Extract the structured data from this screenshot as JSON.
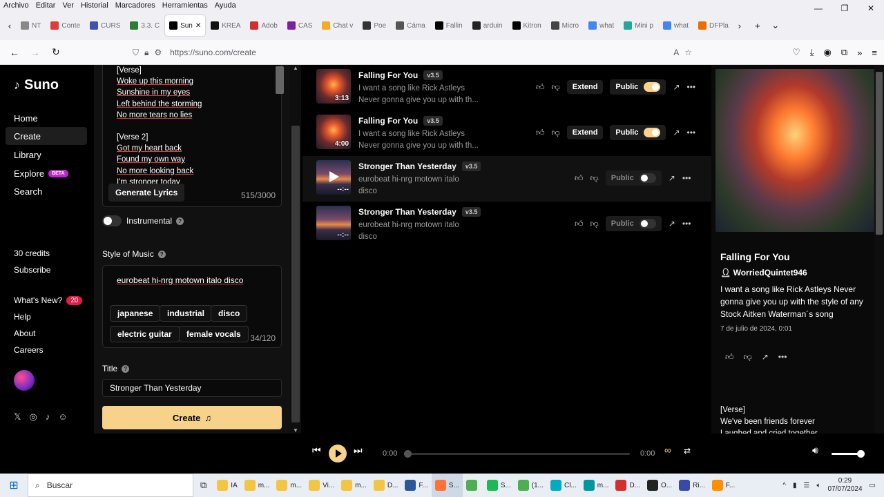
{
  "browser": {
    "menu": [
      "Archivo",
      "Editar",
      "Ver",
      "Historial",
      "Marcadores",
      "Herramientas",
      "Ayuda"
    ],
    "tabs": [
      {
        "label": "NT",
        "color": "#888888"
      },
      {
        "label": "Conte",
        "color": "#e53935"
      },
      {
        "label": "CURS",
        "color": "#3f51b5"
      },
      {
        "label": "3.3. C",
        "color": "#2e7d32"
      },
      {
        "label": "Sun",
        "color": "#000000",
        "active": true
      },
      {
        "label": "KREA",
        "color": "#111111"
      },
      {
        "label": "Adob",
        "color": "#d32f2f"
      },
      {
        "label": "CAS",
        "color": "#7b1fa2"
      },
      {
        "label": "Chat v",
        "color": "#f9a825"
      },
      {
        "label": "Poe",
        "color": "#333333"
      },
      {
        "label": "Cáma",
        "color": "#555555"
      },
      {
        "label": "Fallin",
        "color": "#000000"
      },
      {
        "label": "arduin",
        "color": "#222222"
      },
      {
        "label": "Kitron",
        "color": "#000000"
      },
      {
        "label": "Micro",
        "color": "#444444"
      },
      {
        "label": "what",
        "color": "#4285f4"
      },
      {
        "label": "Mini p",
        "color": "#26a69a"
      },
      {
        "label": "what",
        "color": "#4285f4"
      },
      {
        "label": "DFPla",
        "color": "#ef6c00"
      }
    ],
    "close_tab": "✕",
    "url": "https://suno.com/create"
  },
  "sidebar": {
    "brand": "Suno",
    "nav": [
      {
        "label": "Home"
      },
      {
        "label": "Create",
        "active": true
      },
      {
        "label": "Library"
      },
      {
        "label": "Explore",
        "badge": "BETA"
      },
      {
        "label": "Search"
      }
    ],
    "credits": "30 credits",
    "subscribe": "Subscribe",
    "whats_new": "What's New?",
    "whats_new_count": "20",
    "help": "Help",
    "about": "About",
    "careers": "Careers"
  },
  "create": {
    "lyrics": [
      {
        "text": "[Verse]",
        "u": false
      },
      {
        "text": "Woke up this morning",
        "u": true
      },
      {
        "text": "Sunshine in my eyes",
        "u": true
      },
      {
        "text": "Left behind the storming",
        "u": true
      },
      {
        "text": "No more tears no lies",
        "u": true
      },
      {
        "text": "",
        "u": false
      },
      {
        "text": "[Verse 2]",
        "u": false
      },
      {
        "text": "Got my heart back",
        "u": true
      },
      {
        "text": "Found my own way",
        "u": true
      },
      {
        "text": "No more looking back",
        "u": true
      },
      {
        "text": "I'm stronger today",
        "u": true
      }
    ],
    "generate_lyrics": "Generate Lyrics",
    "lyrics_count": "515/3000",
    "instrumental": "Instrumental",
    "style_label": "Style of Music",
    "style_value": "eurobeat hi-nrg motown italo disco",
    "style_tags": [
      "japanese",
      "industrial",
      "disco",
      "electric guitar",
      "female vocals"
    ],
    "style_count": "34/120",
    "title_label": "Title",
    "title_value": "Stronger Than Yesterday",
    "create_button": "Create"
  },
  "songs": [
    {
      "title": "Falling For You",
      "version": "v3.5",
      "desc1": "I want a song like Rick Astleys",
      "desc2": "Never gonna give you up with th...",
      "duration": "3:13",
      "thumb": "heart",
      "public": true,
      "extend": "Extend",
      "public_label": "Public"
    },
    {
      "title": "Falling For You",
      "version": "v3.5",
      "desc1": "I want a song like Rick Astleys",
      "desc2": "Never gonna give you up with th...",
      "duration": "4:00",
      "thumb": "heart",
      "public": true,
      "extend": "Extend",
      "public_label": "Public"
    },
    {
      "title": "Stronger Than Yesterday",
      "version": "v3.5",
      "desc1": "eurobeat hi-nrg motown italo",
      "desc2": "disco",
      "duration": "--:--",
      "thumb": "sunset",
      "public": false,
      "public_label": "Public",
      "playing": true
    },
    {
      "title": "Stronger Than Yesterday",
      "version": "v3.5",
      "desc1": "eurobeat hi-nrg motown italo",
      "desc2": "disco",
      "duration": "--:--",
      "thumb": "sunset",
      "public": false,
      "public_label": "Public"
    }
  ],
  "detail": {
    "title": "Falling For You",
    "user": "WorriedQuintet946",
    "desc": "I want a song like Rick Astleys Never gonna give you up with the style of any Stock Aitken Waterman´s song",
    "date": "7 de julio de 2024, 0:01",
    "lyrics_1": "[Verse]",
    "lyrics_2": "We've been friends forever",
    "lyrics_3": "Laughed and cried together"
  },
  "player": {
    "current": "0:00",
    "total": "0:00",
    "progress": 0
  },
  "taskbar": {
    "search": "Buscar",
    "items": [
      {
        "label": "IA",
        "color": "#f4c542"
      },
      {
        "label": "m...",
        "color": "#f4c542"
      },
      {
        "label": "m...",
        "color": "#f4c542"
      },
      {
        "label": "Vi...",
        "color": "#f4c542"
      },
      {
        "label": "m...",
        "color": "#f4c542"
      },
      {
        "label": "D...",
        "color": "#f4c542"
      },
      {
        "label": "F...",
        "color": "#2b579a"
      },
      {
        "label": "S...",
        "color": "#ff7139",
        "active": true
      },
      {
        "label": "",
        "color": "#4caf50"
      },
      {
        "label": "S...",
        "color": "#1db954"
      },
      {
        "label": "(1...",
        "color": "#4caf50"
      },
      {
        "label": "Cl...",
        "color": "#00acc1"
      },
      {
        "label": "m...",
        "color": "#00979d"
      },
      {
        "label": "D...",
        "color": "#d32f2f"
      },
      {
        "label": "O...",
        "color": "#222222"
      },
      {
        "label": "Ri...",
        "color": "#3949ab"
      },
      {
        "label": "F...",
        "color": "#ff8f00"
      }
    ],
    "time": "0:29",
    "date": "07/07/2024"
  }
}
